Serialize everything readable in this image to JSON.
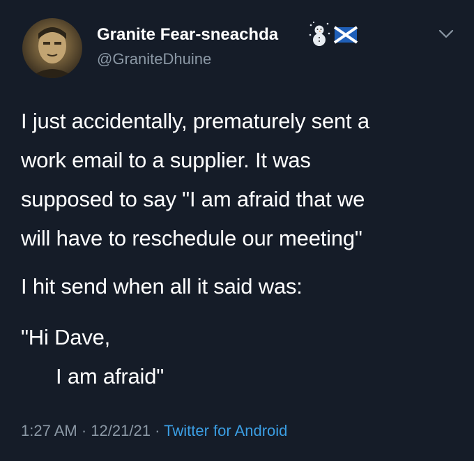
{
  "user": {
    "display_name": "Granite Fear-sneachda",
    "handle": "@GraniteDhuine",
    "name_emojis": [
      "snowman-icon",
      "saltire-flag-icon"
    ]
  },
  "tweet": {
    "paragraph1": [
      "I just accidentally, prematurely sent a",
      "work email to a supplier. It was",
      "supposed to say \"I am afraid that we",
      "will have to reschedule our meeting\""
    ],
    "paragraph2": "I hit send when all it said was:",
    "paragraph3": [
      "\"Hi Dave,",
      "I am afraid\""
    ]
  },
  "meta": {
    "time": "1:27 AM",
    "separator": "·",
    "date": "12/21/21",
    "source": "Twitter for Android"
  },
  "colors": {
    "background": "#151c28",
    "text": "#ffffff",
    "muted": "#8b98a5",
    "link": "#3b9ee3"
  }
}
